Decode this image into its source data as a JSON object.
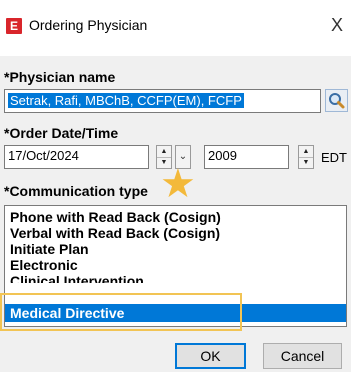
{
  "window": {
    "title": "Ordering Physician",
    "app_icon_letter": "E",
    "close_glyph": "X",
    "partial_top_text": "~~~~~~~~~~~~~~~~~~~~~~~~~~~~"
  },
  "physician": {
    "label": "*Physician name",
    "value": "Setrak, Rafi, MBChB, CCFP(EM), FCFP"
  },
  "order_datetime": {
    "label": "*Order Date/Time",
    "date": "17/Oct/2024",
    "time": "2009",
    "timezone": "EDT"
  },
  "communication": {
    "label": "*Communication type",
    "items": [
      "Phone with Read Back (Cosign)",
      "Verbal with Read Back (Cosign)",
      "Initiate Plan",
      "Electronic",
      "Clinical Intervention",
      "Medical Directive"
    ],
    "selected": "Medical Directive"
  },
  "buttons": {
    "ok": "OK",
    "cancel": "Cancel"
  },
  "annotation": {
    "star_glyph": "★",
    "star_color": "#f3b93a",
    "highlight_color": "#f2c454"
  },
  "colors": {
    "selection": "#0078d7",
    "app_icon": "#d9252b"
  }
}
